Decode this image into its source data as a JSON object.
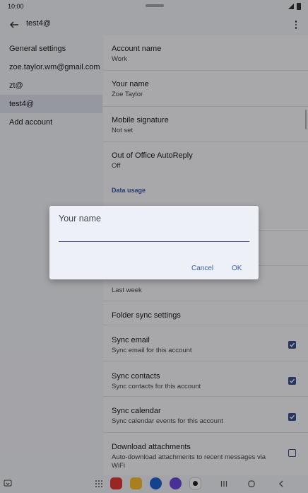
{
  "status": {
    "time": "10:00"
  },
  "appbar": {
    "title": "test4@"
  },
  "sidebar": {
    "items": [
      {
        "label": "General settings"
      },
      {
        "label": "zoe.taylor.wm@gmail.com"
      },
      {
        "label": "zt@"
      },
      {
        "label": "test4@"
      },
      {
        "label": "Add account"
      }
    ]
  },
  "settings": {
    "account_name": {
      "title": "Account name",
      "value": "Work"
    },
    "your_name": {
      "title": "Your name",
      "value": "Zoe Taylor"
    },
    "mobile_signature": {
      "title": "Mobile signature",
      "value": "Not set"
    },
    "out_of_office": {
      "title": "Out of Office AutoReply",
      "value": "Off"
    },
    "data_usage_header": "Data usage",
    "sync_emails_from": {
      "value": "Last week"
    },
    "folder_sync": {
      "title": "Folder sync settings"
    },
    "sync_email": {
      "title": "Sync email",
      "sub": "Sync email for this account",
      "checked": true
    },
    "sync_contacts": {
      "title": "Sync contacts",
      "sub": "Sync contacts for this account",
      "checked": true
    },
    "sync_calendar": {
      "title": "Sync calendar",
      "sub": "Sync calendar events for this account",
      "checked": true
    },
    "download_attachments": {
      "title": "Download attachments",
      "sub": "Auto-download attachments to recent messages via WiFi",
      "checked": false
    }
  },
  "dialog": {
    "title": "Your name",
    "input_value": "",
    "cancel_label": "Cancel",
    "ok_label": "OK"
  },
  "colors": {
    "accent": "#3b5ba9",
    "checkbox": "#3d4f94"
  },
  "icons": [
    "back-arrow-icon",
    "more-vert-icon",
    "signal-icon",
    "battery-icon",
    "apps-grid-icon",
    "recents-icon",
    "home-icon",
    "back-nav-icon"
  ]
}
